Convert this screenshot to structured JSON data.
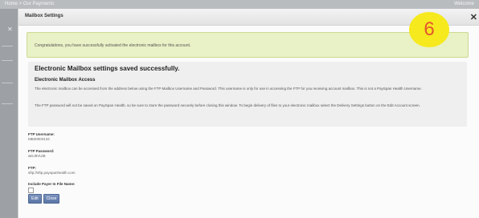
{
  "background": {
    "breadcrumb": "Home > Our Payments",
    "user_text": "Welcome"
  },
  "dialog": {
    "title": "Mailbox Settings",
    "close_glyph": "✕",
    "step_number": "6",
    "notice": "Congratulations, you have successfully activated the electronic mailbox for this account.",
    "heading": "Electronic Mailbox settings saved successfully.",
    "subheading": "Electronic Mailbox Access",
    "paragraph1": "The electronic mailbox can be accessed from the address below using the FTP Mailbox Username and Password. This username is only for use in accessing the FTP for you receiving account mailbox. This is not a PaySpan Health Username.",
    "paragraph2": "The FTP password will not be saved on PaySpan Health, so be sure to store the password securely before closing this window. To begin delivery of files to your electronic mailbox select the Delivery Settings button on the Edit Account screen.",
    "fields": {
      "username_label": "FTP Username:",
      "username_value": "MB30003134",
      "password_label": "FTP Password:",
      "password_value": "wDJ9VUiB",
      "ftp_label": "FTP:",
      "ftp_value": "sftp://sftp.payspanhealth.com",
      "include_payer_label": "Include Payer In File Name:"
    },
    "buttons": {
      "edit": "Edit",
      "close": "Close"
    }
  }
}
